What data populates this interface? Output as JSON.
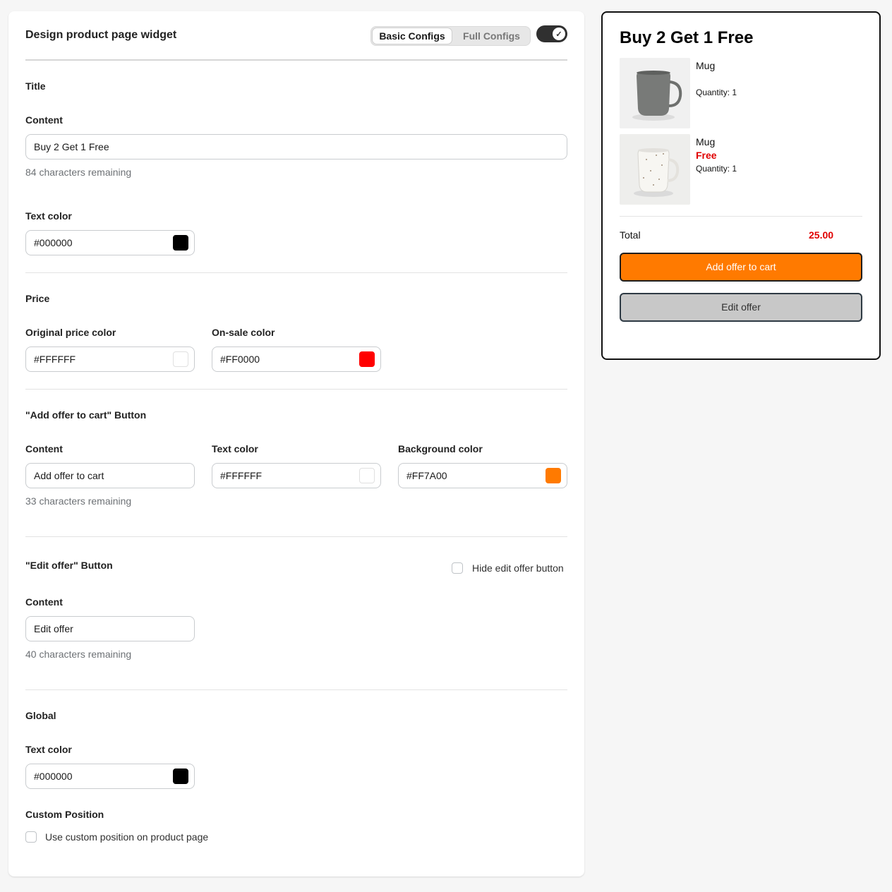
{
  "header": {
    "title": "Design product page widget",
    "tabs": [
      {
        "label": "Basic Configs",
        "active": true
      },
      {
        "label": "Full Configs",
        "active": false
      }
    ],
    "toggle_on": true
  },
  "title_section": {
    "heading": "Title",
    "content_label": "Content",
    "content_value": "Buy 2 Get 1 Free",
    "content_help": "84 characters remaining",
    "text_color_label": "Text color",
    "text_color_value": "#000000",
    "text_color_swatch": "#000000"
  },
  "price_section": {
    "heading": "Price",
    "original_label": "Original price color",
    "original_value": "#FFFFFF",
    "original_swatch": "#FFFFFF",
    "sale_label": "On-sale color",
    "sale_value": "#FF0000",
    "sale_swatch": "#FF0000"
  },
  "add_button_section": {
    "heading": "\"Add offer to cart\" Button",
    "content_label": "Content",
    "content_value": "Add offer to cart",
    "content_help": "33 characters remaining",
    "text_color_label": "Text color",
    "text_color_value": "#FFFFFF",
    "text_color_swatch": "#FFFFFF",
    "bg_color_label": "Background color",
    "bg_color_value": "#FF7A00",
    "bg_color_swatch": "#FF7A00"
  },
  "edit_button_section": {
    "heading": "\"Edit offer\" Button",
    "hide_label": "Hide edit offer button",
    "hide_checked": false,
    "content_label": "Content",
    "content_value": "Edit offer",
    "content_help": "40 characters remaining"
  },
  "global_section": {
    "heading": "Global",
    "text_color_label": "Text color",
    "text_color_value": "#000000",
    "text_color_swatch": "#000000",
    "custom_position_label": "Custom Position",
    "custom_position_checkbox_label": "Use custom position on product page",
    "custom_position_checked": false
  },
  "preview": {
    "title": "Buy 2 Get 1 Free",
    "items": [
      {
        "name": "Mug",
        "badge": "",
        "quantity": "Quantity: 1",
        "image": "mug-gray-icon"
      },
      {
        "name": "Mug",
        "badge": "Free",
        "quantity": "Quantity: 1",
        "image": "mug-speckled-icon"
      }
    ],
    "total_label": "Total",
    "total_value": "25.00",
    "add_button": "Add offer to cart",
    "edit_button": "Edit offer",
    "add_button_color": "#FF7A00",
    "sale_color": "#E00000"
  }
}
